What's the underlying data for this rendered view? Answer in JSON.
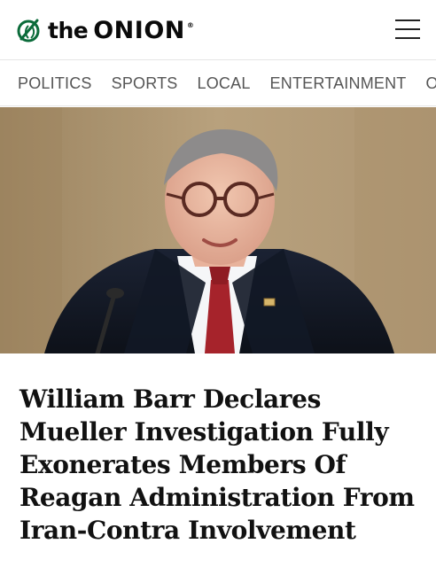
{
  "header": {
    "logo": {
      "the": "the",
      "onion": "ONION",
      "registered": "®"
    }
  },
  "nav": {
    "items": [
      {
        "label": "POLITICS"
      },
      {
        "label": "SPORTS"
      },
      {
        "label": "LOCAL"
      },
      {
        "label": "ENTERTAINMENT"
      },
      {
        "label": "OPINION"
      }
    ]
  },
  "article": {
    "headline": "William Barr Declares Mueller Investigation Fully Exonerates Members Of Reagan Administration From Iran-Contra Involvement"
  },
  "colors": {
    "brand_green": "#0b6b3a",
    "text": "#111111",
    "nav_text": "#555555"
  },
  "icons": {
    "logo": "onion-logo-icon",
    "menu": "hamburger-menu-icon"
  }
}
